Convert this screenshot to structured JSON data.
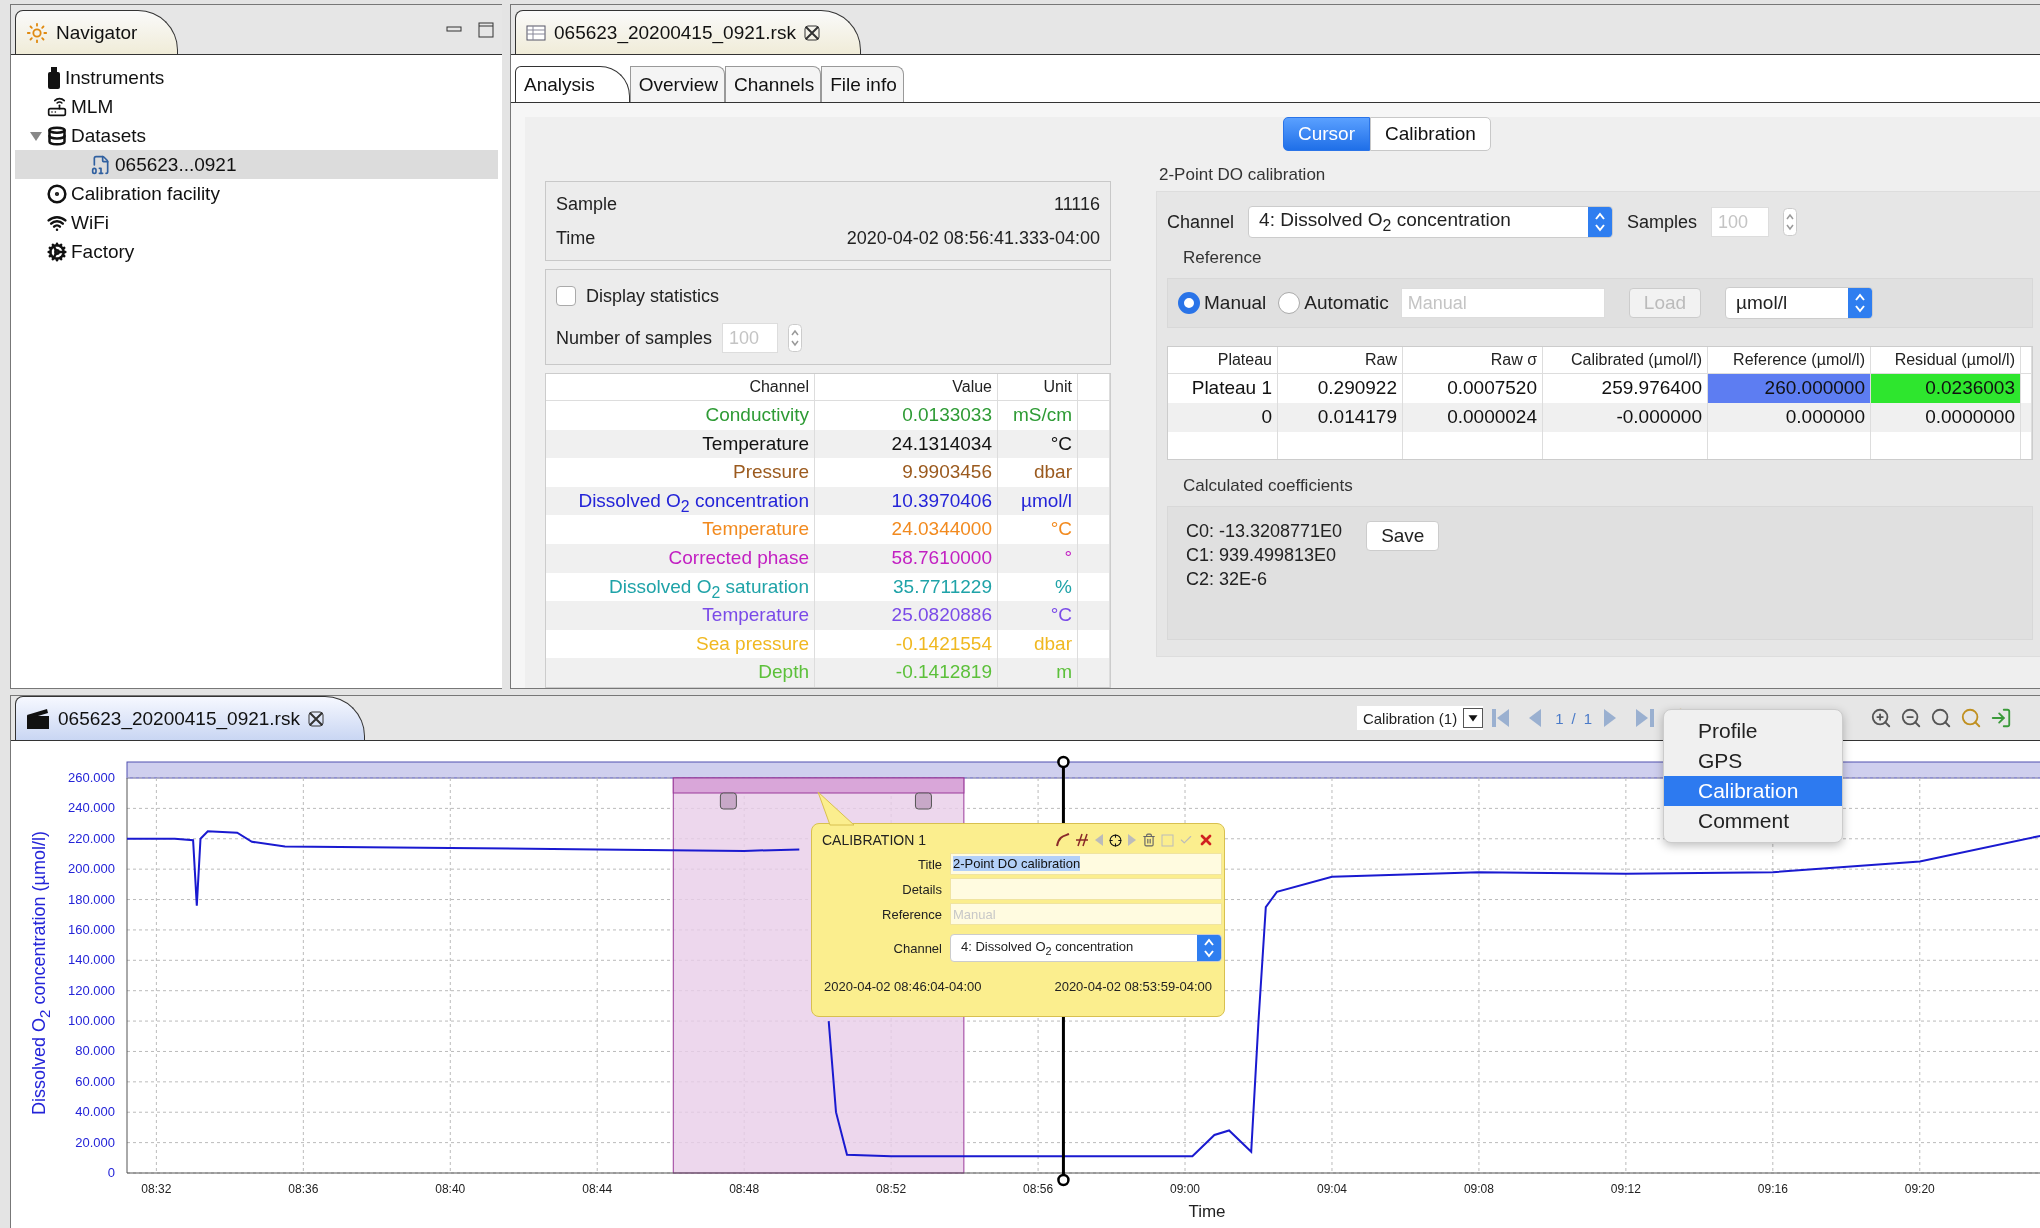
{
  "navigator": {
    "title": "Navigator",
    "tree": [
      {
        "label": "Instruments",
        "kind": "instrument",
        "selected": false
      },
      {
        "label": "MLM",
        "kind": "device",
        "selected": false
      },
      {
        "label": "Datasets",
        "kind": "database",
        "selected": false,
        "expanded": true,
        "children": [
          {
            "label": "065623...0921",
            "kind": "file",
            "selected": true
          }
        ]
      },
      {
        "label": "Calibration facility",
        "kind": "facility",
        "selected": false
      },
      {
        "label": "WiFi",
        "kind": "wifi",
        "selected": false
      },
      {
        "label": "Factory",
        "kind": "factory",
        "selected": false
      }
    ]
  },
  "editor": {
    "tab": "065623_20200415_0921.rsk",
    "subtabs": [
      {
        "label": "Analysis",
        "selected": true
      },
      {
        "label": "Overview",
        "selected": false
      },
      {
        "label": "Channels",
        "selected": false
      },
      {
        "label": "File info",
        "selected": false
      }
    ],
    "modes": [
      {
        "label": "Cursor",
        "selected": true
      },
      {
        "label": "Calibration",
        "selected": false
      }
    ],
    "cursor": {
      "fields": [
        {
          "label": "Sample",
          "value": "11116"
        },
        {
          "label": "Time",
          "value": "2020-04-02 08:56:41.333-04:00"
        }
      ],
      "display_statistics": {
        "label": "Display statistics",
        "checked": false
      },
      "number_of_samples": {
        "label": "Number of samples",
        "placeholder": "100"
      }
    },
    "channels_table": {
      "columns": [
        "Channel",
        "Value",
        "Unit"
      ],
      "rows": [
        {
          "channel": "Conductivity",
          "value": "0.0133033",
          "unit": "mS/cm",
          "color": "#2e9b35"
        },
        {
          "channel": "Temperature",
          "value": "24.1314034",
          "unit": "°C",
          "color": "#111111"
        },
        {
          "channel": "Pressure",
          "value": "9.9903456",
          "unit": "dbar",
          "color": "#9b5a1e"
        },
        {
          "channel": "Dissolved O$_{2}$ concentration",
          "value": "10.3970406",
          "unit": "µmol/l",
          "color": "#2424d8"
        },
        {
          "channel": "Temperature",
          "value": "24.0344000",
          "unit": "°C",
          "color": "#f28a1e"
        },
        {
          "channel": "Corrected phase",
          "value": "58.7610000",
          "unit": "°",
          "color": "#c21fc2"
        },
        {
          "channel": "Dissolved O$_{2}$ saturation",
          "value": "35.7711229",
          "unit": "%",
          "color": "#1fa3a8"
        },
        {
          "channel": "Temperature",
          "value": "25.0820886",
          "unit": "°C",
          "color": "#7a4ae8"
        },
        {
          "channel": "Sea pressure",
          "value": "-0.1421554",
          "unit": "dbar",
          "color": "#f0b820"
        },
        {
          "channel": "Depth",
          "value": "-0.1412819",
          "unit": "m",
          "color": "#5cc03a"
        }
      ]
    },
    "calibration": {
      "title": "2-Point DO calibration",
      "channel_label": "Channel",
      "channel": "4: Dissolved O$_{2}$ concentration",
      "samples_label": "Samples",
      "samples_placeholder": "100",
      "reference": {
        "title": "Reference",
        "options": [
          {
            "label": "Manual",
            "selected": true
          },
          {
            "label": "Automatic",
            "selected": false
          }
        ],
        "placeholder": "Manual",
        "load": {
          "label": "Load",
          "disabled": true
        },
        "unit": "µmol/l"
      },
      "table": {
        "columns": [
          "Plateau",
          "Raw",
          "Raw σ",
          "Calibrated (µmol/l)",
          "Reference (µmol/l)",
          "Residual (µmol/l)"
        ],
        "rows": [
          {
            "cells": [
              {
                "text": "Plateau 1"
              },
              {
                "text": "0.290922"
              },
              {
                "text": "0.0007520"
              },
              {
                "text": "259.976400"
              },
              {
                "text": "260.000000",
                "color": "#5d7df2"
              },
              {
                "text": "0.0236003",
                "color": "#2ee62e"
              }
            ]
          },
          {
            "cells": [
              {
                "text": "0"
              },
              {
                "text": "0.014179"
              },
              {
                "text": "0.0000024"
              },
              {
                "text": "-0.000000"
              },
              {
                "text": "0.000000"
              },
              {
                "text": "0.0000000"
              }
            ]
          }
        ]
      },
      "coefficients": {
        "title": "Calculated coefficients",
        "lines": [
          "C0: -13.3208771E0",
          "C1: 939.499813E0",
          "C2: 32E-6"
        ],
        "save": "Save"
      }
    }
  },
  "plot": {
    "tab": "065623_20200415_0921.rsk",
    "toolbar": {
      "filter": "Calibration (1)",
      "page": "1",
      "separator": "/",
      "pages": "1"
    },
    "menu": [
      {
        "label": "Profile",
        "selected": false
      },
      {
        "label": "GPS",
        "selected": false
      },
      {
        "label": "Calibration",
        "selected": true
      },
      {
        "label": "Comment",
        "selected": false
      }
    ],
    "chart_data": {
      "type": "line",
      "xlabel": "Time",
      "ylabel": "Dissolved O$_{2}$ concentration (µmol/l)",
      "x": [
        511.2,
        512.5,
        513.0,
        513.1,
        513.2,
        513.4,
        514.2,
        514.6,
        515.5,
        520,
        524,
        528,
        529.5,
        530.2,
        530.3,
        530.5,
        530.8,
        532,
        536,
        540.2,
        540.8,
        541.2,
        541.8,
        542.0,
        542.2,
        542.5,
        544,
        548,
        552,
        556,
        560,
        563.3
      ],
      "grid": true,
      "bands": [
        {
          "axis": "x",
          "from": 526.07,
          "to": 533.98
        }
      ],
      "ref_lines": [
        {
          "axis": "x",
          "value": 536.69
        }
      ],
      "series": [
        {
          "color": "#1a1ad0",
          "values": [
            220,
            220,
            219,
            176,
            220,
            225,
            224,
            218,
            215,
            214,
            213,
            212,
            213,
            null,
            100,
            40,
            12,
            11,
            11,
            11,
            25,
            28,
            14,
            100,
            175,
            185,
            195,
            198,
            197,
            198,
            205,
            222
          ]
        }
      ],
      "xlim": [
        511.2,
        563.3
      ],
      "ylim": [
        0,
        260
      ],
      "xticks": [
        {
          "value": 512,
          "label": "08:32"
        },
        {
          "value": 516,
          "label": "08:36"
        },
        {
          "value": 520,
          "label": "08:40"
        },
        {
          "value": 524,
          "label": "08:44"
        },
        {
          "value": 528,
          "label": "08:48"
        },
        {
          "value": 532,
          "label": "08:52"
        },
        {
          "value": 536,
          "label": "08:56"
        },
        {
          "value": 540,
          "label": "09:00"
        },
        {
          "value": 544,
          "label": "09:04"
        },
        {
          "value": 548,
          "label": "09:08"
        },
        {
          "value": 552,
          "label": "09:12"
        },
        {
          "value": 556,
          "label": "09:16"
        },
        {
          "value": 560,
          "label": "09:20"
        }
      ],
      "yticks": [
        {
          "value": 0,
          "label": "0"
        },
        {
          "value": 20,
          "label": "20.000"
        },
        {
          "value": 40,
          "label": "40.000"
        },
        {
          "value": 60,
          "label": "60.000"
        },
        {
          "value": 80,
          "label": "80.000"
        },
        {
          "value": 100,
          "label": "100.000"
        },
        {
          "value": 120,
          "label": "120.000"
        },
        {
          "value": 140,
          "label": "140.000"
        },
        {
          "value": 160,
          "label": "160.000"
        },
        {
          "value": 180,
          "label": "180.000"
        },
        {
          "value": 200,
          "label": "200.000"
        },
        {
          "value": 220,
          "label": "220.000"
        },
        {
          "value": 240,
          "label": "240.000"
        },
        {
          "value": 260,
          "label": "260.000"
        }
      ]
    },
    "popup": {
      "title": "CALIBRATION 1",
      "fields": [
        {
          "label": "Title",
          "value": "2-Point DO calibration"
        },
        {
          "label": "Details"
        },
        {
          "label": "Reference",
          "placeholder": "Manual"
        }
      ],
      "channel_label": "Channel",
      "channel": "4: Dissolved O$_{2}$ concentration",
      "start": "2020-04-02 08:46:04-04:00",
      "end": "2020-04-02 08:53:59-04:00"
    }
  }
}
